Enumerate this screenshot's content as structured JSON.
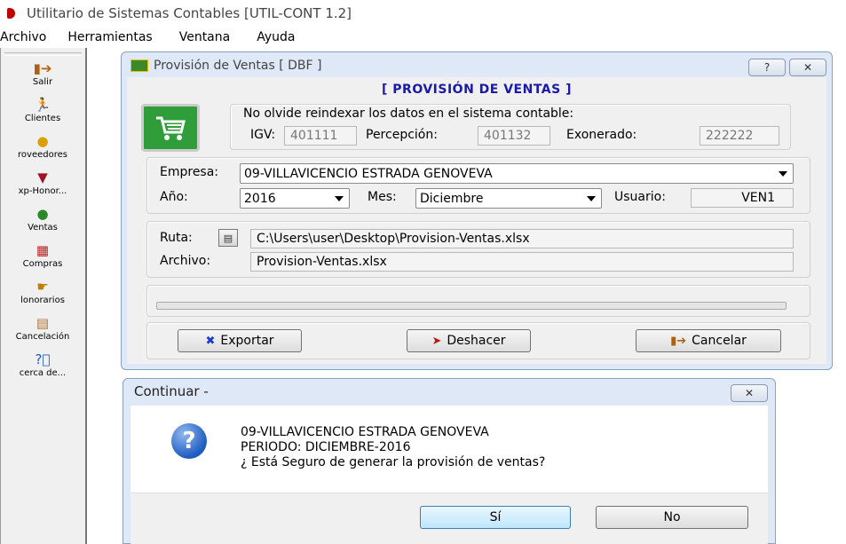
{
  "app": {
    "title": "Utilitario de Sistemas Contables [UTIL-CONT 1.2]"
  },
  "menubar": {
    "items": [
      "Archivo",
      "Herramientas",
      "Ventana",
      "Ayuda"
    ]
  },
  "sidebar": {
    "items": [
      {
        "label": "Salir",
        "icon": "door-exit-icon"
      },
      {
        "label": "Clientes",
        "icon": "person-icon"
      },
      {
        "label": "roveedores",
        "icon": "users-icon"
      },
      {
        "label": "xp-Honor...",
        "icon": "fees-icon"
      },
      {
        "label": "Ventas",
        "icon": "money-bag-icon"
      },
      {
        "label": "Compras",
        "icon": "purchases-icon"
      },
      {
        "label": "lonorarios",
        "icon": "hand-icon"
      },
      {
        "label": "Cancelación",
        "icon": "cancel-grid-icon"
      },
      {
        "label": "cerca de...",
        "icon": "help-icon"
      }
    ]
  },
  "main_dialog": {
    "title": "Provisión de Ventas [ DBF ]",
    "heading": "[ PROVISIÓN DE VENTAS ]",
    "help_button": "?",
    "close_button": "✕",
    "notice": "No olvide reindexar los datos en el sistema contable:",
    "igv_label": "IGV:",
    "igv_value": "401111",
    "percepcion_label": "Percepción:",
    "percepcion_value": "401132",
    "exonerado_label": "Exonerado:",
    "exonerado_value": "222222",
    "empresa_label": "Empresa:",
    "empresa_value": "09-VILLAVICENCIO ESTRADA GENOVEVA",
    "anio_label": "Año:",
    "anio_value": "2016",
    "mes_label": "Mes:",
    "mes_value": "Diciembre",
    "usuario_label": "Usuario:",
    "usuario_value": "VEN1",
    "ruta_label": "Ruta:",
    "ruta_value": "C:\\Users\\user\\Desktop\\Provision-Ventas.xlsx",
    "archivo_label": "Archivo:",
    "archivo_value": "Provision-Ventas.xlsx",
    "progress": 0,
    "exportar_label": "Exportar",
    "deshacer_label": "Deshacer",
    "cancelar_label": "Cancelar"
  },
  "confirm_dialog": {
    "title": "Continuar -",
    "close_button": "✕",
    "line1": "09-VILLAVICENCIO ESTRADA GENOVEVA",
    "line2": "PERIODO: DICIEMBRE-2016",
    "line3": "¿ Está Seguro de generar la provisión de ventas?",
    "yes_label": "Sí",
    "no_label": "No"
  },
  "colors": {
    "heading": "#1a1aa8",
    "dialog_frame": "#dfe8f6",
    "cart": "#2f9e3a",
    "question_icon": "#1f5cc0"
  }
}
